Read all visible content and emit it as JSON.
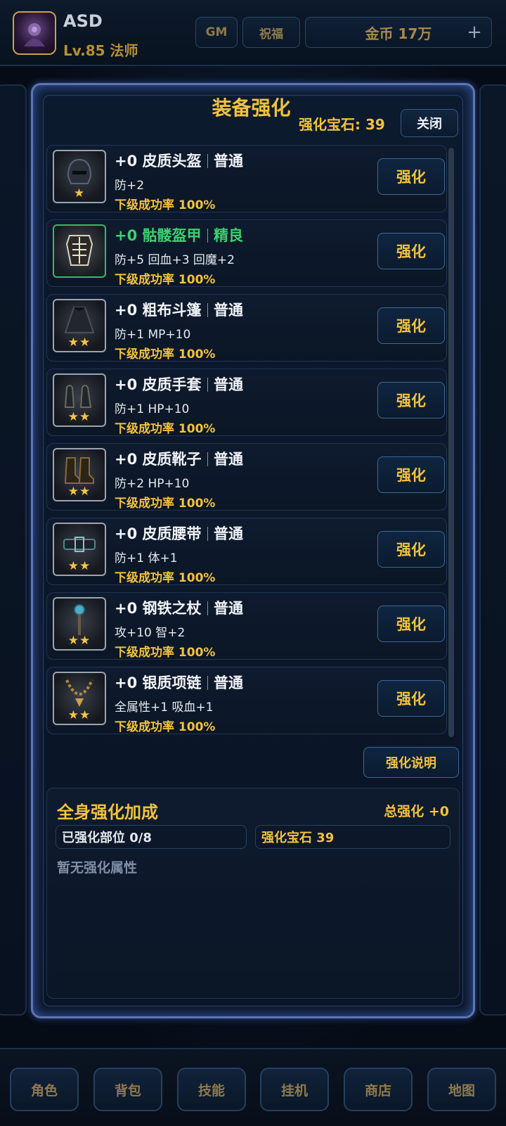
{
  "player": {
    "name": "ASD",
    "level_text": "Lv.85  法师"
  },
  "header": {
    "gm_label": "GM",
    "bless_label": "祝福",
    "gold_label": "金币 17万",
    "plus_label": "+"
  },
  "panel": {
    "title": "装备强化",
    "gem_label": "强化宝石: 39",
    "close_label": "关闭",
    "explain_label": "强化说明"
  },
  "items": [
    {
      "name": "+0 皮质头盔",
      "quality": "普通",
      "stats": "防+2",
      "rate": "下级成功率 100%",
      "stars": "★",
      "button": "强化"
    },
    {
      "name": "+0 骷髅盔甲",
      "quality": "精良",
      "stats": "防+5  回血+3  回魔+2",
      "rate": "下级成功率 100%",
      "stars": "",
      "button": "强化"
    },
    {
      "name": "+0 粗布斗篷",
      "quality": "普通",
      "stats": "防+1  MP+10",
      "rate": "下级成功率 100%",
      "stars": "★★",
      "button": "强化"
    },
    {
      "name": "+0 皮质手套",
      "quality": "普通",
      "stats": "防+1  HP+10",
      "rate": "下级成功率 100%",
      "stars": "★★",
      "button": "强化"
    },
    {
      "name": "+0 皮质靴子",
      "quality": "普通",
      "stats": "防+2  HP+10",
      "rate": "下级成功率 100%",
      "stars": "★★",
      "button": "强化"
    },
    {
      "name": "+0 皮质腰带",
      "quality": "普通",
      "stats": "防+1  体+1",
      "rate": "下级成功率 100%",
      "stars": "★★",
      "button": "强化"
    },
    {
      "name": "+0 钢铁之杖",
      "quality": "普通",
      "stats": "攻+10  智+2",
      "rate": "下级成功率 100%",
      "stars": "★★",
      "button": "强化"
    },
    {
      "name": "+0 银质项链",
      "quality": "普通",
      "stats": "全属性+1  吸血+1",
      "rate": "下级成功率 100%",
      "stars": "★★",
      "button": "强化"
    }
  ],
  "bonus": {
    "title": "全身强化加成",
    "total": "总强化 +0",
    "parts": "已强化部位  0/8",
    "gems": "强化宝石  39",
    "none": "暂无强化属性"
  },
  "nav": [
    "角色",
    "背包",
    "技能",
    "挂机",
    "商店",
    "地图"
  ],
  "colors": {
    "accent_gold": "#f2c23c",
    "rare_green": "#3ccf72",
    "panel_border": "#5e74b4"
  }
}
